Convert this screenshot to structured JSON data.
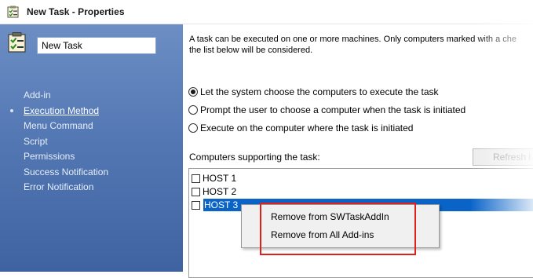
{
  "window": {
    "title": "New Task - Properties",
    "icon": "task-properties-icon"
  },
  "sidebar": {
    "task_icon": "task-checklist-icon",
    "task_name": "New Task",
    "items": [
      {
        "label": "Add-in"
      },
      {
        "label": "Execution Method"
      },
      {
        "label": "Menu Command"
      },
      {
        "label": "Script"
      },
      {
        "label": "Permissions"
      },
      {
        "label": "Success Notification"
      },
      {
        "label": "Error Notification"
      }
    ],
    "active_item": "Execution Method"
  },
  "main": {
    "description_line1": "A task can be executed on one or more machines. Only computers marked with a che",
    "description_line2": "the list below will be considered.",
    "radio_options": [
      {
        "label": "Let the system choose the computers to execute the task",
        "selected": true
      },
      {
        "label": "Prompt the user to choose a computer when the task is initiated",
        "selected": false
      },
      {
        "label": "Execute on the computer where the task is initiated",
        "selected": false
      }
    ],
    "computers_label": "Computers supporting the task:",
    "refresh_button": "Refresh l",
    "computers": [
      {
        "name": "HOST 1",
        "checked": false,
        "selected": false
      },
      {
        "name": "HOST 2",
        "checked": false,
        "selected": false
      },
      {
        "name": "HOST 3",
        "checked": false,
        "selected": true
      }
    ]
  },
  "context_menu": {
    "items": [
      {
        "label": "Remove from SWTaskAddIn"
      },
      {
        "label": "Remove from All Add-ins"
      }
    ]
  },
  "colors": {
    "sidebar_top": "#6c8ec4",
    "sidebar_bottom": "#3f63a0",
    "selection": "#0a64c8",
    "annotation": "#e0201c"
  }
}
